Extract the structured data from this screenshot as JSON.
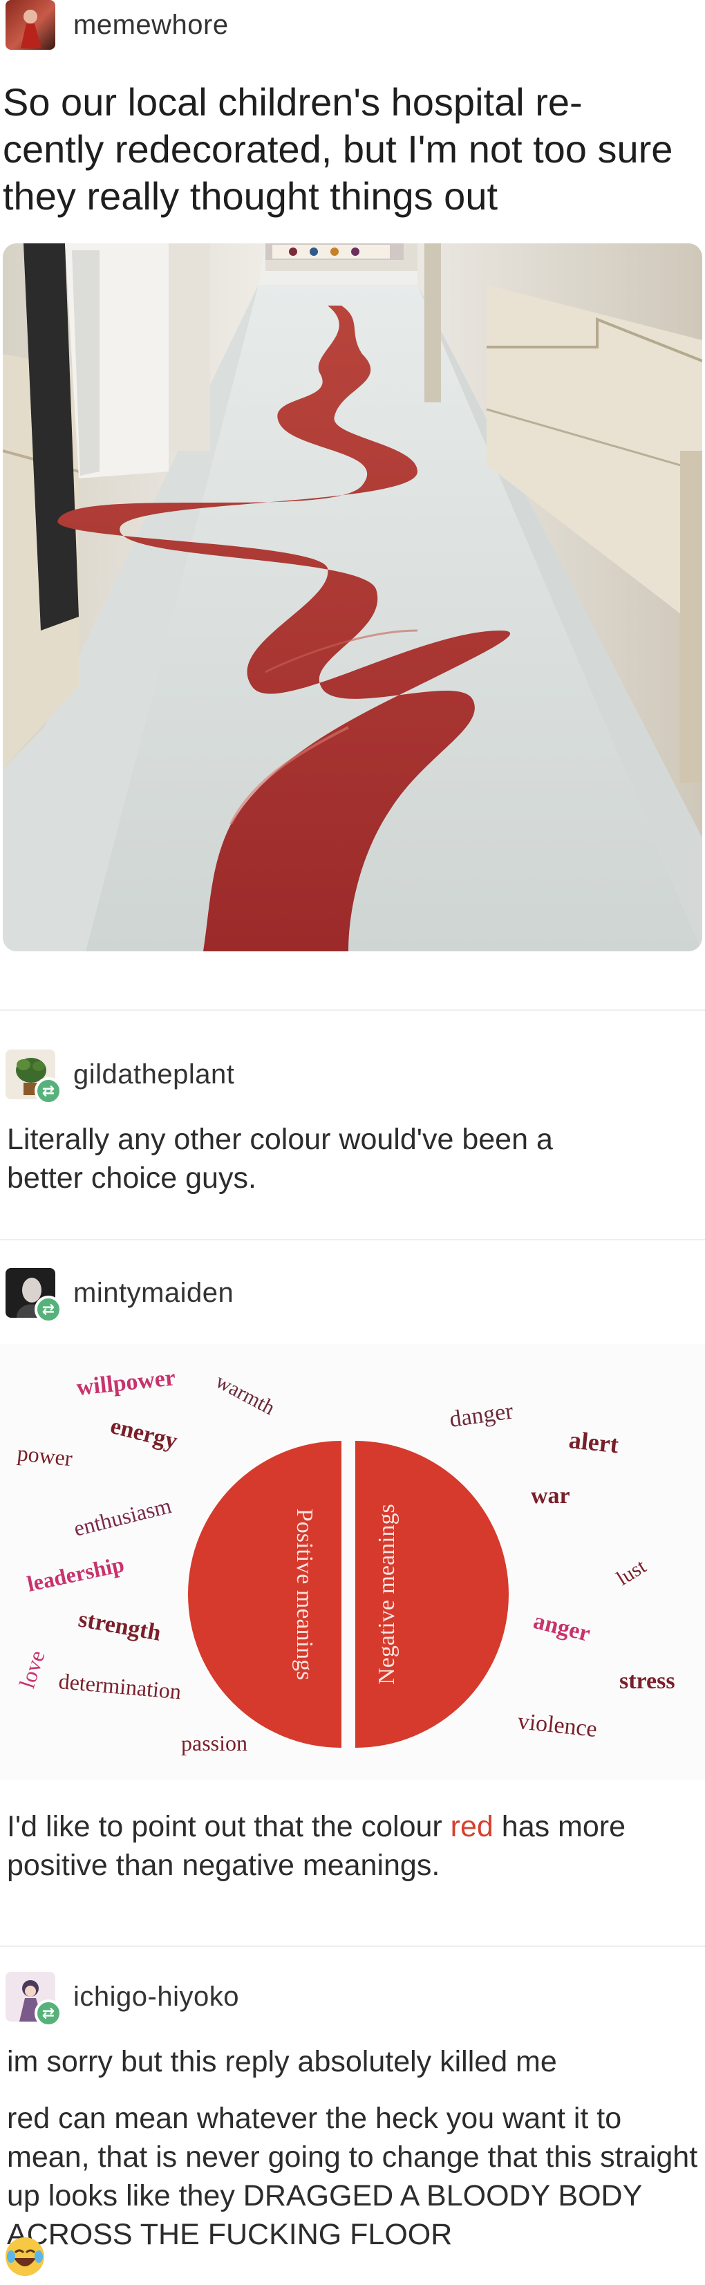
{
  "post1": {
    "username": "memewhore",
    "text": "So our local children's hospital re- cently redecorated, but I'm not too sure they really thought things out"
  },
  "reply1": {
    "username": "gildatheplant",
    "text": "Literally any other colour would've been a better choice guys."
  },
  "reply2": {
    "username": "mintymaiden",
    "text_before": "I'd like to point out that the colour ",
    "text_highlight": "red",
    "text_after": " has more positive than negative meanings."
  },
  "reply3": {
    "username": "ichigo-hiyoko",
    "text1": "im sorry but this reply absolutely killed me",
    "text2": "red can mean whatever the heck you want it to mean, that is never going to change that this straight up looks like they DRAGGED A BLOODY BODY ACROSS THE FUCKING FLOOR"
  },
  "graphic": {
    "left_half_label": "Positive meanings",
    "right_half_label": "Negative meanings",
    "positive_words": [
      "willpower",
      "warmth",
      "energy",
      "power",
      "enthusiasm",
      "leadership",
      "love",
      "strength",
      "determination",
      "passion"
    ],
    "negative_words": [
      "danger",
      "alert",
      "war",
      "lust",
      "anger",
      "stress",
      "violence"
    ]
  },
  "colors": {
    "accent_red": "#d4412e",
    "reblog_badge": "#56b27a",
    "word_pink": "#c8336c"
  },
  "icons": {
    "reblog": "reblog-icon",
    "emoji": "laughing-crying-emoji"
  }
}
